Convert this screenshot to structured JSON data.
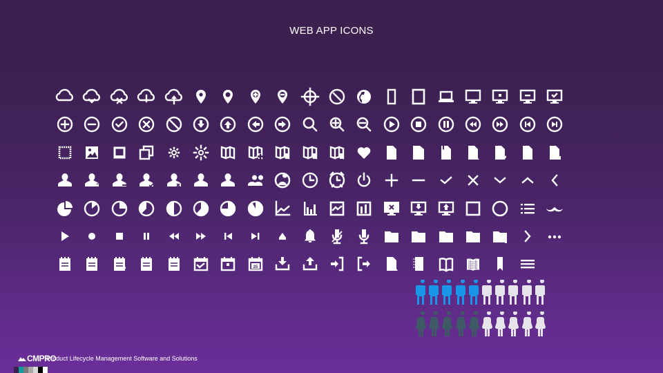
{
  "title": "WEB APP ICONS",
  "footer": {
    "logo_text": "CMPRO",
    "tagline": "Product Lifecycle Management Software and Solutions"
  },
  "colors": {
    "icon": "#ffffff",
    "male_highlight": "#1a96e8",
    "female_highlight": "#3d5a66",
    "person_default": "#e6e4ea",
    "swatches": [
      "#3b1f4e",
      "#0e9a9e",
      "#7a7a7a",
      "#a8a8a8",
      "#d8d8d8",
      "#000000",
      "#ffffff"
    ]
  },
  "icon_rows": [
    [
      "cloud",
      "cloud-sync",
      "cloud-error",
      "cloud-download",
      "cloud-upload",
      "map-pin",
      "map-pin-outline",
      "map-pin-add",
      "map-pin-remove",
      "crosshair",
      "compass",
      "globe",
      "smartphone",
      "tablet",
      "laptop",
      "monitor",
      "monitor-add",
      "monitor-remove",
      "monitor-check"
    ],
    [
      "circle-add",
      "circle-remove",
      "circle-check",
      "circle-close",
      "circle-block",
      "circle-arrow-down",
      "circle-arrow-up",
      "circle-arrow-left",
      "circle-arrow-right",
      "search",
      "zoom-in",
      "zoom-out",
      "circle-play",
      "circle-stop",
      "circle-pause",
      "circle-rewind",
      "circle-fast-forward",
      "circle-skip-back",
      "circle-skip-forward"
    ],
    [
      "frame",
      "image",
      "photo",
      "copy",
      "brightness-low",
      "brightness-high",
      "map",
      "map-add",
      "map-remove",
      "map-check",
      "map-close",
      "heart",
      "file",
      "file-copy",
      "file-bookmark",
      "file-folded",
      "file-edit",
      "file-close",
      "file-lock"
    ],
    [
      "user",
      "user-edit",
      "user-remove",
      "user-check",
      "user-close",
      "user-add",
      "user-solid",
      "users",
      "user-circle",
      "clock",
      "alarm",
      "power",
      "plus",
      "minus",
      "check",
      "close",
      "chevron-down",
      "chevron-up",
      "chevron-left"
    ],
    [
      "pie-chart",
      "progress-quarter",
      "progress-third",
      "progress-half-outline",
      "progress-half",
      "progress-two-thirds",
      "progress-three-quarters",
      "progress-almost",
      "line-chart",
      "bar-chart",
      "chart-box",
      "bar-chart-box",
      "monitor-close",
      "monitor-download",
      "monitor-upload",
      "square",
      "circle",
      "list",
      "mustache"
    ],
    [
      "play",
      "record",
      "stop",
      "pause",
      "rewind",
      "fast-forward",
      "skip-back",
      "skip-forward",
      "eject",
      "bell",
      "mic-off",
      "mic",
      "folder",
      "folder-open",
      "folder-solid",
      "folder-edit",
      "folder-add",
      "chevron-right",
      "more"
    ],
    [
      "note",
      "note-2",
      "note-edit",
      "note-remove",
      "note-list",
      "calendar-check",
      "calendar-add",
      "calendar-date",
      "download",
      "upload",
      "sign-in",
      "sign-out",
      "document",
      "notebook",
      "book-open",
      "book-grid",
      "bookmark",
      "menu"
    ]
  ],
  "calendar_day": "25",
  "pictogram": {
    "male_total": 10,
    "male_highlighted": 5,
    "female_total": 10,
    "female_highlighted": 5
  }
}
